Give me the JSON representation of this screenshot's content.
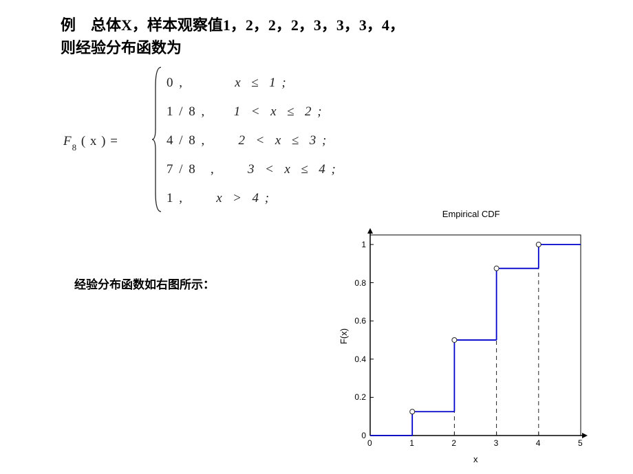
{
  "title_line1": "例　总体X，样本观察值1，2，2，2，3，3，3，4，",
  "title_line2": "则经验分布函数为",
  "equation": {
    "lhs": "F",
    "lhs_sub": "8",
    "lhs_rest": " ( x )  =",
    "pieces": [
      {
        "val": "0 ,",
        "cond_prefix": "           ",
        "cond": "x  ≤  1 ;"
      },
      {
        "val": "1 / 8 ,",
        "cond_prefix": "      ",
        "cond": "1  <  x  ≤  2 ;"
      },
      {
        "val": "4 / 8 ,",
        "cond_prefix": "       ",
        "cond": "2  <  x  ≤  3 ;"
      },
      {
        "val": "7 / 8   ,",
        "cond_prefix": "       ",
        "cond": "3  <  x  ≤  4 ;"
      },
      {
        "val": "1 ,",
        "cond_prefix": "       ",
        "cond": "x  >  4 ;"
      }
    ]
  },
  "caption": "经验分布函数如右图所示：",
  "chart_data": {
    "type": "step",
    "title": "Empirical CDF",
    "xlabel": "x",
    "ylabel": "F(x)",
    "xlim": [
      0,
      5
    ],
    "ylim": [
      0,
      1.05
    ],
    "xticks": [
      0,
      1,
      2,
      3,
      4,
      5
    ],
    "yticks": [
      0,
      0.2,
      0.4,
      0.6,
      0.8,
      1
    ],
    "steps": [
      {
        "x_start": 0,
        "x_end": 1,
        "y": 0
      },
      {
        "x_start": 1,
        "x_end": 2,
        "y": 0.125
      },
      {
        "x_start": 2,
        "x_end": 3,
        "y": 0.5
      },
      {
        "x_start": 3,
        "x_end": 4,
        "y": 0.875
      },
      {
        "x_start": 4,
        "x_end": 5,
        "y": 1.0
      }
    ],
    "open_circles": [
      {
        "x": 1,
        "y": 0.125
      },
      {
        "x": 2,
        "y": 0.5
      },
      {
        "x": 3,
        "y": 0.875
      },
      {
        "x": 4,
        "y": 1.0
      }
    ],
    "dashed_verticals": [
      {
        "x": 2,
        "y_from": 0,
        "y_to": 0.5
      },
      {
        "x": 3,
        "y_from": 0,
        "y_to": 0.875
      },
      {
        "x": 4,
        "y_from": 0,
        "y_to": 1.0
      }
    ]
  }
}
